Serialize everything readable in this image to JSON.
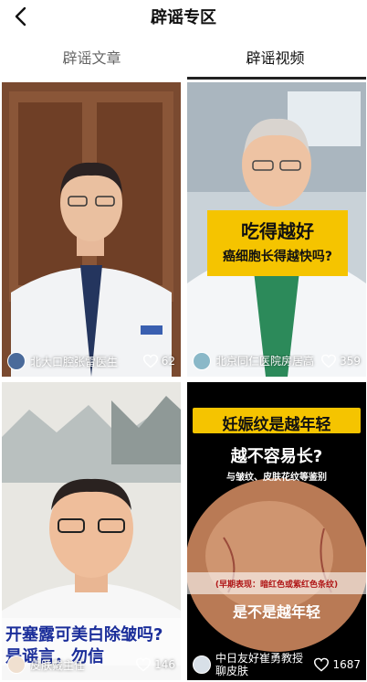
{
  "header": {
    "title": "辟谣专区",
    "back_icon": "chevron-left-icon"
  },
  "tabs": [
    {
      "label": "辟谣文章",
      "active": false
    },
    {
      "label": "辟谣视频",
      "active": true
    }
  ],
  "videos": [
    {
      "author": "北大口腔张雷医生",
      "likes": "62",
      "overlay": []
    },
    {
      "author": "北京同仁医院房居高",
      "likes": "359",
      "overlay": [
        "吃得越好",
        "癌细胞长得越快吗?"
      ]
    },
    {
      "author": "皮肤戴主任",
      "likes": "146",
      "overlay": [
        "开塞露可美白除皱吗?",
        "是谣言，勿信"
      ]
    },
    {
      "author": "中日友好崔勇教授聊皮肤",
      "likes": "1687",
      "overlay": [
        "妊娠纹是越年轻",
        "越不容易长?",
        "与皱纹、皮肤花纹等鉴别",
        "(早期表现：暗红色或紫红色条纹)",
        "是不是越年轻"
      ]
    }
  ],
  "colors": {
    "accent_yellow": "#f5c400",
    "highlight_red": "#e6302b",
    "tab_underline": "#222222"
  }
}
